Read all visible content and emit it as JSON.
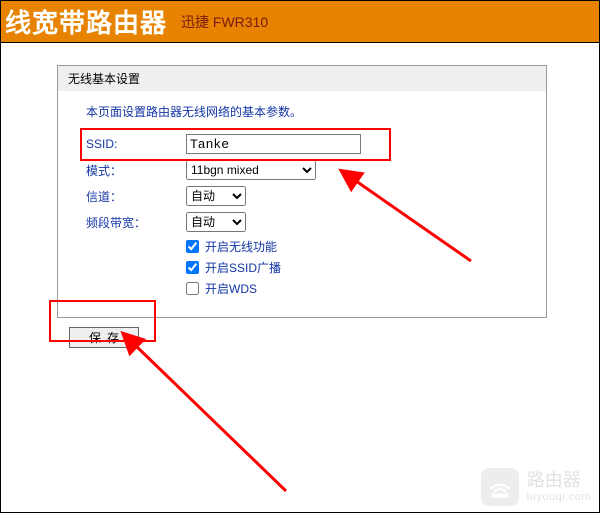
{
  "header": {
    "title_fragment": "线宽带路由器",
    "model": "迅捷 FWR310"
  },
  "panel": {
    "title": "无线基本设置",
    "description": "本页面设置路由器无线网络的基本参数。",
    "fields": {
      "ssid_label": "SSID:",
      "ssid_value": "Tanke",
      "mode_label": "模式：",
      "mode_value": "11bgn mixed",
      "channel_label": "信道：",
      "channel_value": "自动",
      "bandwidth_label": "频段带宽：",
      "bandwidth_value": "自动"
    },
    "checkboxes": {
      "enable_wireless": {
        "label": "开启无线功能",
        "checked": true
      },
      "enable_ssid_broadcast": {
        "label": "开启SSID广播",
        "checked": true
      },
      "enable_wds": {
        "label": "开启WDS",
        "checked": false
      }
    },
    "save_label": "保存"
  },
  "watermark": {
    "text1": "路由器",
    "text2": "luyouqi.com"
  }
}
